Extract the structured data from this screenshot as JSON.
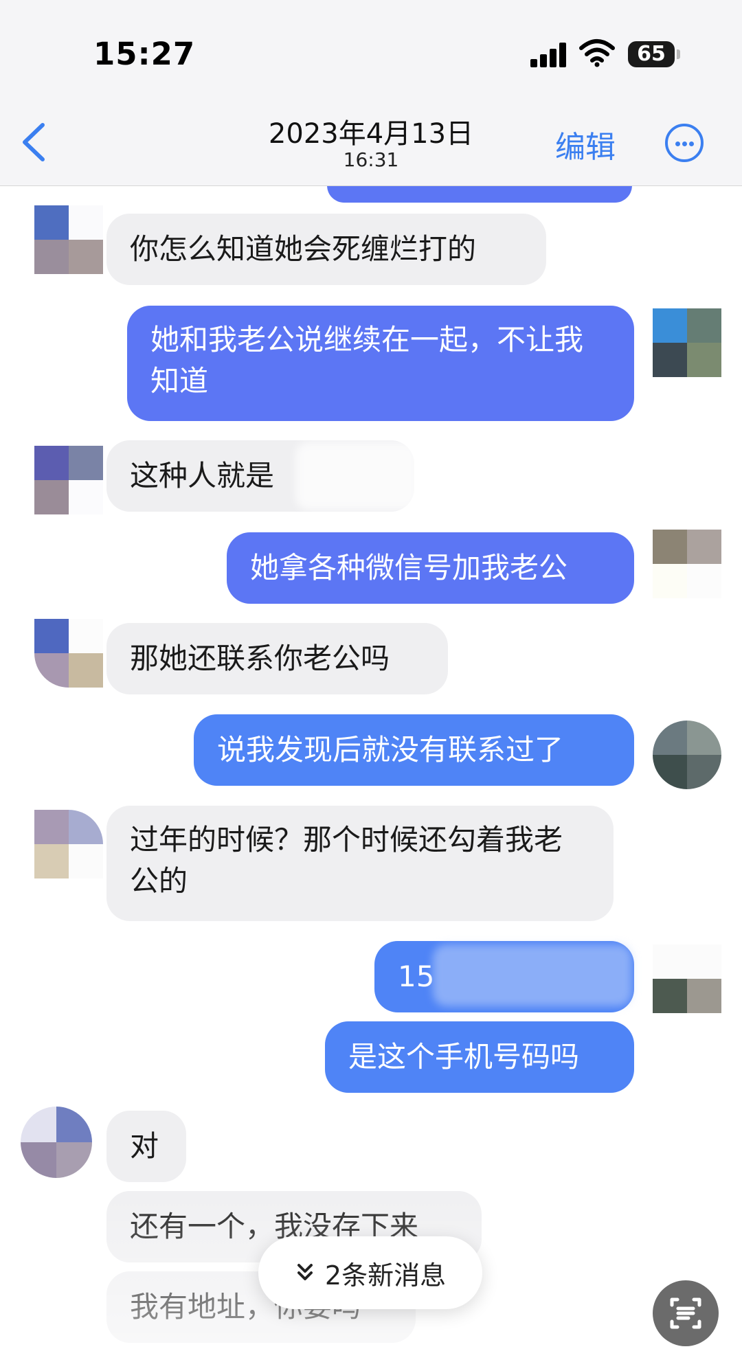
{
  "status_bar": {
    "time": "15:27",
    "battery": "65"
  },
  "nav": {
    "title": "2023年4月13日",
    "subtitle": "16:31",
    "edit_label": "编辑",
    "back_icon": "chevron-left-icon",
    "more_icon": "more-circle-icon"
  },
  "messages": [
    {
      "side": "in",
      "text": "你怎么知道她会死缠烂打的"
    },
    {
      "side": "out",
      "text": "她和我老公说继续在一起，不让我知道"
    },
    {
      "side": "in",
      "text": "这种人就是"
    },
    {
      "side": "out",
      "text": "她拿各种微信号加我老公"
    },
    {
      "side": "in",
      "text": "那她还联系你老公吗"
    },
    {
      "side": "out",
      "text": "说我发现后就没有联系过了"
    },
    {
      "side": "in",
      "text": "过年的时候？那个时候还勾着我老公的"
    },
    {
      "side": "out",
      "text": "15"
    },
    {
      "side": "out",
      "text": "是这个手机号码吗"
    },
    {
      "side": "in",
      "text": "对"
    },
    {
      "side": "in",
      "text": "还有一个，我没存下来"
    },
    {
      "side": "in",
      "text": "我有地址，你要吗"
    }
  ],
  "new_messages": {
    "label": "2条新消息",
    "icon": "double-chevron-down-icon"
  },
  "scan_button": {
    "icon": "scan-text-icon"
  },
  "colors": {
    "accent": "#3b7ff0",
    "outgoing_bubble": "#5c76f4",
    "incoming_bubble": "#efeff1"
  }
}
